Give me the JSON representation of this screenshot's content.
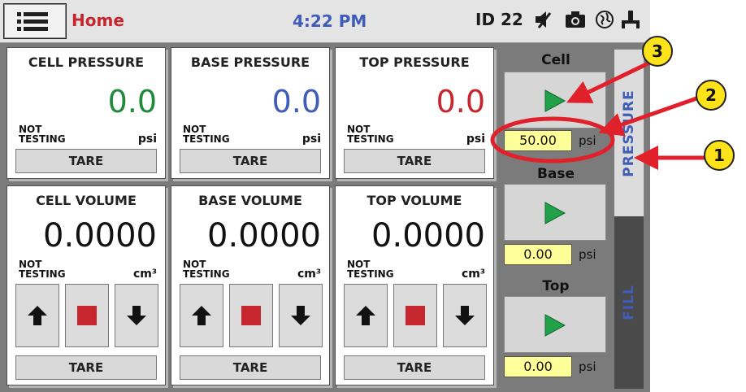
{
  "topbar": {
    "home": "Home",
    "time": "4:22 PM",
    "id": "ID 22"
  },
  "pressure_cards": [
    {
      "title": "CELL PRESSURE",
      "value": "0.0",
      "status": "NOT TESTING",
      "unit": "psi",
      "tare": "TARE",
      "color": "#1f8a3a"
    },
    {
      "title": "BASE PRESSURE",
      "value": "0.0",
      "status": "NOT TESTING",
      "unit": "psi",
      "tare": "TARE",
      "color": "#3f5cb8"
    },
    {
      "title": "TOP PRESSURE",
      "value": "0.0",
      "status": "NOT TESTING",
      "unit": "psi",
      "tare": "TARE",
      "color": "#c6262e"
    }
  ],
  "volume_cards": [
    {
      "title": "CELL VOLUME",
      "value": "0.0000",
      "status": "NOT TESTING",
      "unit": "cm³",
      "tare": "TARE"
    },
    {
      "title": "BASE VOLUME",
      "value": "0.0000",
      "status": "NOT TESTING",
      "unit": "cm³",
      "tare": "TARE"
    },
    {
      "title": "TOP VOLUME",
      "value": "0.0000",
      "status": "NOT TESTING",
      "unit": "cm³",
      "tare": "TARE"
    }
  ],
  "side": {
    "cell": {
      "label": "Cell",
      "setpoint": "50.00",
      "unit": "psi"
    },
    "base": {
      "label": "Base",
      "setpoint": "0.00",
      "unit": "psi"
    },
    "top": {
      "label": "Top",
      "setpoint": "0.00",
      "unit": "psi"
    }
  },
  "tabs": {
    "pressure": "PRESSURE",
    "fill": "FILL"
  },
  "callouts": [
    "1",
    "2",
    "3"
  ],
  "icons": [
    "menu-icon",
    "mute-icon",
    "camera-icon",
    "globe-icon",
    "network-icon",
    "play-icon",
    "arrow-up-icon",
    "stop-icon",
    "arrow-down-icon"
  ],
  "colors": {
    "accent_red": "#c6262e",
    "accent_blue": "#3f5cb8",
    "play_green": "#22a04a",
    "setpoint_yellow": "#ffff99",
    "annotation_red": "#e0202a",
    "callout_yellow": "#ffe31a"
  }
}
